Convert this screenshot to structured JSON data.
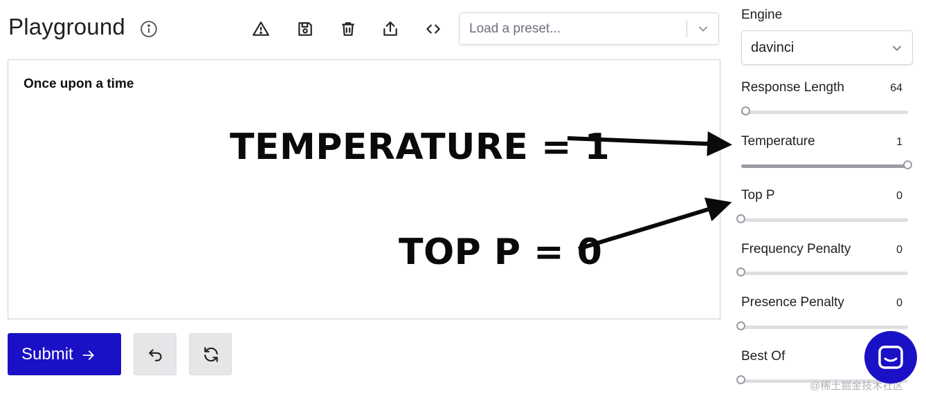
{
  "header": {
    "title": "Playground"
  },
  "toolbar": {
    "icons": [
      "info-icon",
      "warning-icon",
      "save-icon",
      "trash-icon",
      "share-icon",
      "code-icon"
    ],
    "preset_placeholder": "Load a preset..."
  },
  "editor": {
    "text": "Once upon a time"
  },
  "annotations": {
    "temperature": "TEMPERATURE = 1",
    "top_p": "TOP P = 0"
  },
  "actions": {
    "submit_label": "Submit",
    "undo_icon": "undo-icon",
    "regenerate_icon": "refresh-icon"
  },
  "sidebar": {
    "engine_label": "Engine",
    "engine_value": "davinci",
    "params": [
      {
        "label": "Response Length",
        "value": "64",
        "fraction": 0.03
      },
      {
        "label": "Temperature",
        "value": "1",
        "fraction": 1.0
      },
      {
        "label": "Top P",
        "value": "0",
        "fraction": 0.0
      },
      {
        "label": "Frequency Penalty",
        "value": "0",
        "fraction": 0.0
      },
      {
        "label": "Presence Penalty",
        "value": "0",
        "fraction": 0.0
      },
      {
        "label": "Best Of",
        "value": "",
        "fraction": 0.0
      }
    ]
  },
  "watermark": "@稀土掘金技术社区",
  "colors": {
    "accent": "#1a10c6",
    "border": "#d4d4d8",
    "track": "#dedee2",
    "thumb": "#9a9aa2"
  }
}
